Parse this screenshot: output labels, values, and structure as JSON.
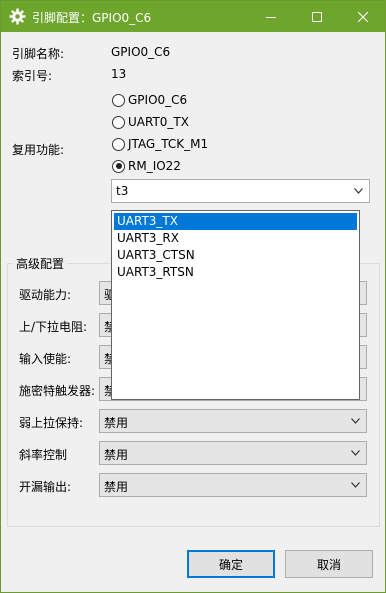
{
  "window": {
    "title": "引脚配置：GPIO0_C6",
    "minimize": "—",
    "maximize": "☐",
    "close": "✕",
    "title_color": "#6ea52d"
  },
  "info": {
    "pin_name_label": "引脚名称:",
    "pin_name_value": "GPIO0_C6",
    "index_label": "索引号:",
    "index_value": "13"
  },
  "mux": {
    "label": "复用功能:",
    "options": [
      {
        "label": "GPIO0_C6",
        "selected": false
      },
      {
        "label": "UART0_TX",
        "selected": false
      },
      {
        "label": "JTAG_TCK_M1",
        "selected": false
      },
      {
        "label": "RM_IO22",
        "selected": true
      }
    ],
    "combo_value": "t3",
    "dropdown_items": [
      "UART3_TX",
      "UART3_RX",
      "UART3_CTSN",
      "UART3_RTSN"
    ],
    "dropdown_highlight": "UART3_TX"
  },
  "advanced": {
    "title": "高级配置",
    "rows": [
      {
        "label": "驱动能力:",
        "value": "驱"
      },
      {
        "label": "上/下拉电阻:",
        "value": "禁"
      },
      {
        "label": "输入使能:",
        "value": "禁"
      },
      {
        "label": "施密特触发器:",
        "value": "禁"
      },
      {
        "label": "弱上拉保持:",
        "value": "禁用"
      },
      {
        "label": "斜率控制",
        "value": "禁用"
      },
      {
        "label": "开漏输出:",
        "value": "禁用"
      }
    ]
  },
  "buttons": {
    "ok": "确定",
    "cancel": "取消"
  }
}
